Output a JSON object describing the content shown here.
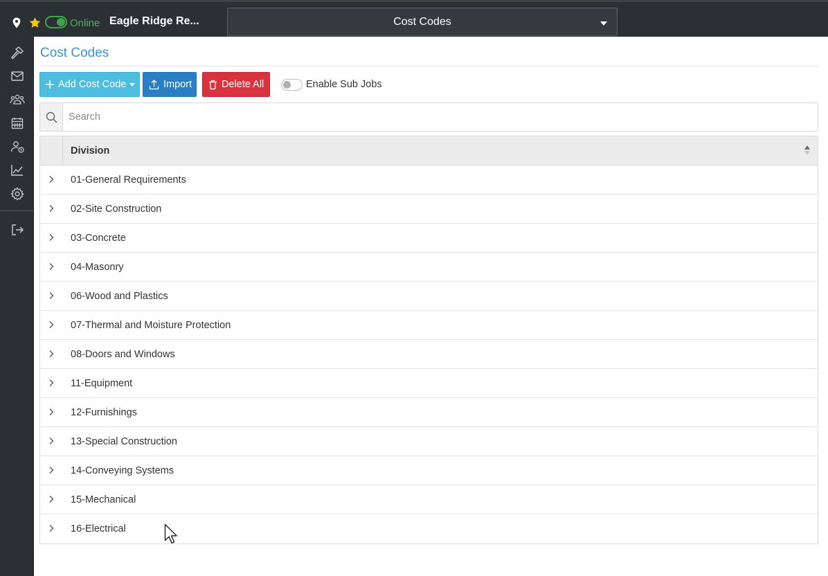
{
  "topbar": {
    "online_label": "Online",
    "project_title": "Eagle Ridge Re...",
    "page_select_value": "Cost Codes",
    "online_color": "#3fa54a",
    "star_color": "#f5c518"
  },
  "sidebar": {
    "items": [
      {
        "icon": "hammer-icon"
      },
      {
        "icon": "envelope-icon"
      },
      {
        "icon": "users-icon"
      },
      {
        "icon": "calendar-icon"
      },
      {
        "icon": "user-clock-icon"
      },
      {
        "icon": "chart-line-icon"
      },
      {
        "icon": "gear-icon"
      },
      {
        "icon": "logout-icon"
      }
    ]
  },
  "main": {
    "heading": "Cost Codes",
    "toolbar": {
      "add_label": "Add Cost Code",
      "import_label": "Import",
      "delete_label": "Delete All",
      "subjobs_label": "Enable Sub Jobs"
    },
    "search": {
      "placeholder": "Search"
    },
    "grid": {
      "column_header": "Division",
      "rows": [
        "01-General Requirements",
        "02-Site Construction",
        "03-Concrete",
        "04-Masonry",
        "06-Wood and Plastics",
        "07-Thermal and Moisture Protection",
        "08-Doors and Windows",
        "11-Equipment",
        "12-Furnishings",
        "13-Special Construction",
        "14-Conveying Systems",
        "15-Mechanical",
        "16-Electrical"
      ]
    }
  }
}
